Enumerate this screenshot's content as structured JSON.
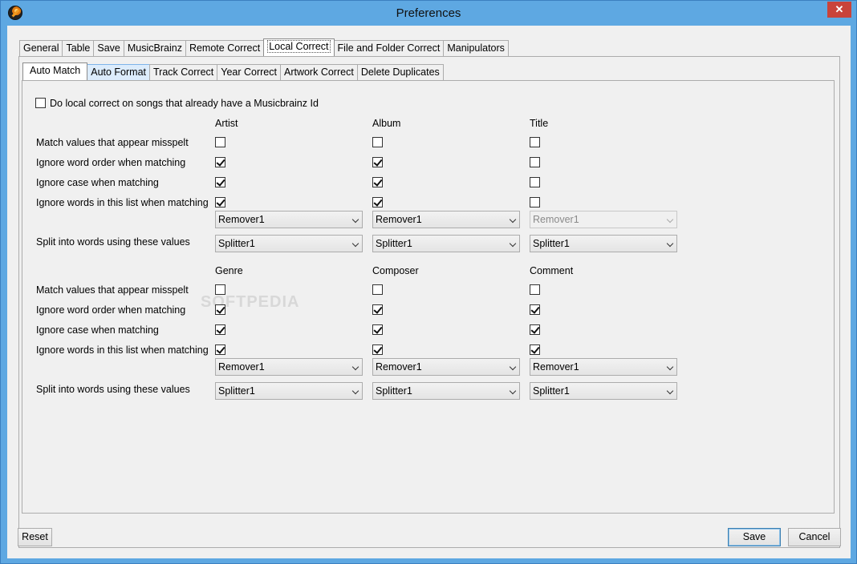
{
  "window": {
    "title": "Preferences",
    "close_glyph": "✕"
  },
  "top_tabs": [
    "General",
    "Table",
    "Save",
    "MusicBrainz",
    "Remote Correct",
    "Local Correct",
    "File and Folder Correct",
    "Manipulators"
  ],
  "top_tabs_active": "Local Correct",
  "sub_tabs": [
    "Auto Match",
    "Auto Format",
    "Track Correct",
    "Year Correct",
    "Artwork Correct",
    "Delete Duplicates"
  ],
  "sub_tabs_active": "Auto Match",
  "top_checkbox": {
    "label": "Do local correct on songs that already have a Musicbrainz Id",
    "checked": false
  },
  "row_labels": {
    "misspelt": "Match values that appear misspelt",
    "word_order": "Ignore word order when matching",
    "case": "Ignore case when matching",
    "words_list": "Ignore words in this list when matching",
    "split": "Split into words using these values"
  },
  "section1": {
    "columns": [
      {
        "name": "Artist",
        "misspelt": false,
        "word_order": true,
        "case": true,
        "words_list": true,
        "remover": "Remover1",
        "remover_enabled": true,
        "splitter": "Splitter1"
      },
      {
        "name": "Album",
        "misspelt": false,
        "word_order": true,
        "case": true,
        "words_list": true,
        "remover": "Remover1",
        "remover_enabled": true,
        "splitter": "Splitter1"
      },
      {
        "name": "Title",
        "misspelt": false,
        "word_order": false,
        "case": false,
        "words_list": false,
        "remover": "Remover1",
        "remover_enabled": false,
        "splitter": "Splitter1"
      }
    ]
  },
  "section2": {
    "columns": [
      {
        "name": "Genre",
        "misspelt": false,
        "word_order": true,
        "case": true,
        "words_list": true,
        "remover": "Remover1",
        "remover_enabled": true,
        "splitter": "Splitter1"
      },
      {
        "name": "Composer",
        "misspelt": false,
        "word_order": true,
        "case": true,
        "words_list": true,
        "remover": "Remover1",
        "remover_enabled": true,
        "splitter": "Splitter1"
      },
      {
        "name": "Comment",
        "misspelt": false,
        "word_order": true,
        "case": true,
        "words_list": true,
        "remover": "Remover1",
        "remover_enabled": true,
        "splitter": "Splitter1"
      }
    ]
  },
  "buttons": {
    "reset": "Reset",
    "save": "Save",
    "cancel": "Cancel"
  },
  "watermark": "SOFTPEDIA"
}
